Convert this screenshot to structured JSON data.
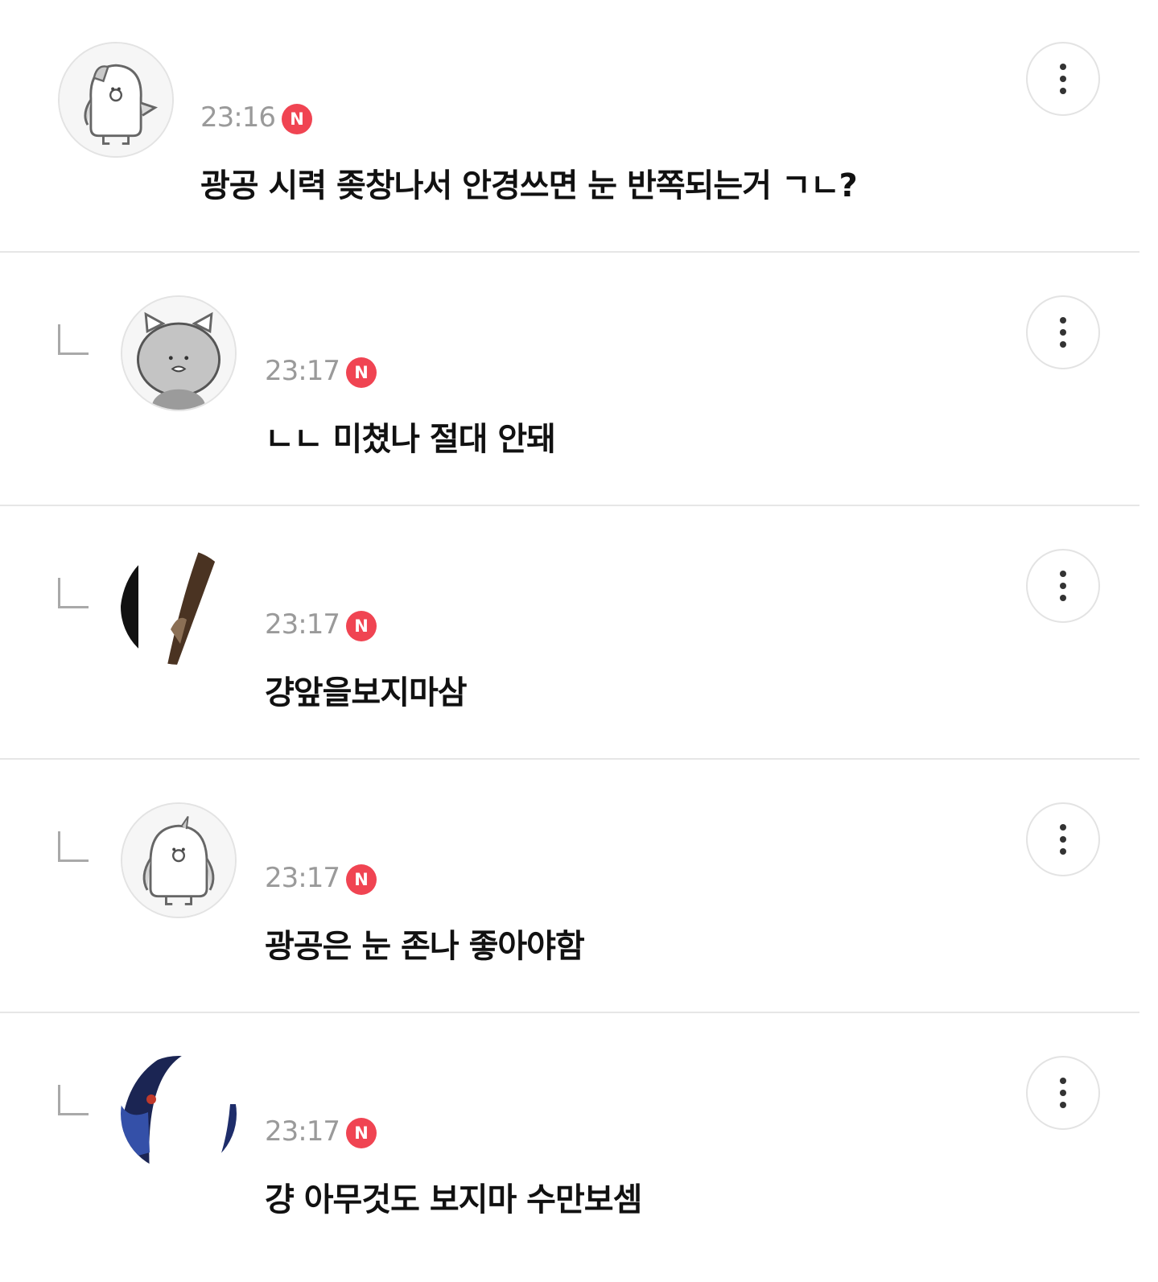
{
  "comments": [
    {
      "type": "root",
      "avatar": "penguin-mascot-avatar",
      "time": "23:16",
      "badge": "N",
      "text": "광공 시력 좆창나서 안경쓰면 눈 반쪽되는거 ㄱㄴ?"
    },
    {
      "type": "reply",
      "avatar": "cat-mascot-avatar",
      "time": "23:17",
      "badge": "N",
      "text": "ㄴㄴ 미쳤나 절대 안돼"
    },
    {
      "type": "reply",
      "avatar": "photo-avatar",
      "time": "23:17",
      "badge": "N",
      "text": "걍앞을보지마삼"
    },
    {
      "type": "reply",
      "avatar": "penguin-mascot-avatar",
      "time": "23:17",
      "badge": "N",
      "text": "광공은 눈 존나 좋아야함"
    },
    {
      "type": "reply",
      "avatar": "photo-avatar",
      "time": "23:17",
      "badge": "N",
      "text": "걍 아무것도 보지마 수만보셈"
    }
  ],
  "colors": {
    "badge": "#f04452",
    "time": "#9a9a9a",
    "divider": "#e6e6e6",
    "text": "#111111"
  },
  "icons": {
    "more": "more-vertical-icon",
    "reply": "reply-arrow-icon"
  }
}
